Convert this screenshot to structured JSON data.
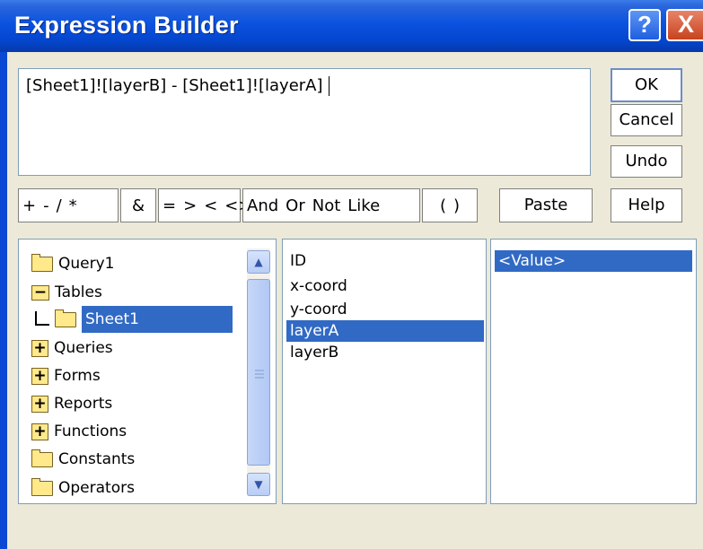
{
  "window": {
    "title": "Expression Builder",
    "help_glyph": "?",
    "close_glyph": "X"
  },
  "expression": {
    "text": "[Sheet1]![layerB] - [Sheet1]![layerA]"
  },
  "buttons": {
    "ok": "OK",
    "cancel": "Cancel",
    "undo": "Undo",
    "paste": "Paste",
    "help": "Help"
  },
  "operators": [
    "+",
    "-",
    "/",
    "*",
    "&",
    "=",
    ">",
    "<",
    "<>",
    "And",
    "Or",
    "Not",
    "Like",
    "(",
    ")"
  ],
  "tree": [
    {
      "label": "Query1"
    },
    {
      "label": "Tables"
    },
    {
      "label": "Sheet1",
      "selected": true
    },
    {
      "label": "Queries"
    },
    {
      "label": "Forms"
    },
    {
      "label": "Reports"
    },
    {
      "label": "Functions"
    },
    {
      "label": "Constants"
    },
    {
      "label": "Operators"
    }
  ],
  "fields": [
    {
      "label": "ID"
    },
    {
      "label": "x-coord"
    },
    {
      "label": "y-coord"
    },
    {
      "label": "layerA",
      "selected": true
    },
    {
      "label": "layerB"
    }
  ],
  "values": [
    {
      "label": "<Value>",
      "selected": true
    }
  ],
  "colors": {
    "titlebar": "#0a52e0",
    "selection": "#316ac5",
    "dialog_bg": "#ece9d8"
  }
}
